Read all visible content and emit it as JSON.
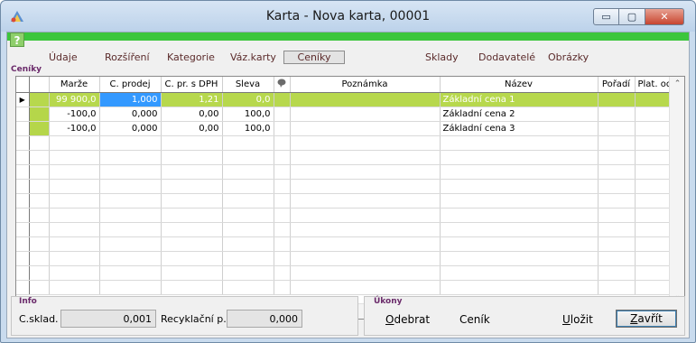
{
  "window": {
    "title": "Karta - Nova karta, 00001",
    "buttons": {
      "minimize": "▭",
      "maximize": "▢",
      "close": "✕"
    },
    "help_label": "?"
  },
  "tabs": [
    {
      "label": "Údaje"
    },
    {
      "label": "Rozšíření"
    },
    {
      "label": "Kategorie"
    },
    {
      "label": "Váz.karty"
    },
    {
      "label": "Ceníky",
      "active": true
    },
    {
      "label": "Sklady"
    },
    {
      "label": "Dodavatelé"
    },
    {
      "label": "Obrázky"
    }
  ],
  "pricelist": {
    "group_label": "Ceníky",
    "columns": [
      "Marže",
      "C. prodej",
      "C. pr. s DPH",
      "Sleva",
      "",
      "Poznámka",
      "Název",
      "Pořadí",
      "Plat. od"
    ],
    "note_icon": "speech-bubble-icon",
    "rows": [
      {
        "marze": "99 900,0",
        "c_prodej": "1,000",
        "c_pr_dph": "1,21",
        "sleva": "0,0",
        "poznamka": "",
        "nazev": "Základní cena 1",
        "poradi": "",
        "plat_od": "",
        "selected": true
      },
      {
        "marze": "-100,0",
        "c_prodej": "0,000",
        "c_pr_dph": "0,00",
        "sleva": "100,0",
        "poznamka": "",
        "nazev": "Základní cena 2",
        "poradi": "",
        "plat_od": ""
      },
      {
        "marze": "-100,0",
        "c_prodej": "0,000",
        "c_pr_dph": "0,00",
        "sleva": "100,0",
        "poznamka": "",
        "nazev": "Základní cena 3",
        "poradi": "",
        "plat_od": ""
      }
    ],
    "row_indicator": "▶"
  },
  "info": {
    "group_label": "Info",
    "c_sklad_label": "C.sklad.",
    "c_sklad_value": "0,001",
    "recyklacni_label": "Recyklační p.",
    "recyklacni_value": "0,000"
  },
  "actions": {
    "group_label": "Úkony",
    "odebrat_pre": "O",
    "odebrat_rest": "debrat",
    "cenik_label": "Ceník",
    "ulozit_pre": "U",
    "ulozit_rest": "ložit",
    "zavrit_pre": "Z",
    "zavrit_rest": "avřít"
  },
  "colors": {
    "accent_green": "#3cc63c",
    "row_highlight": "#b7d84d",
    "cell_focus": "#3399ff"
  }
}
